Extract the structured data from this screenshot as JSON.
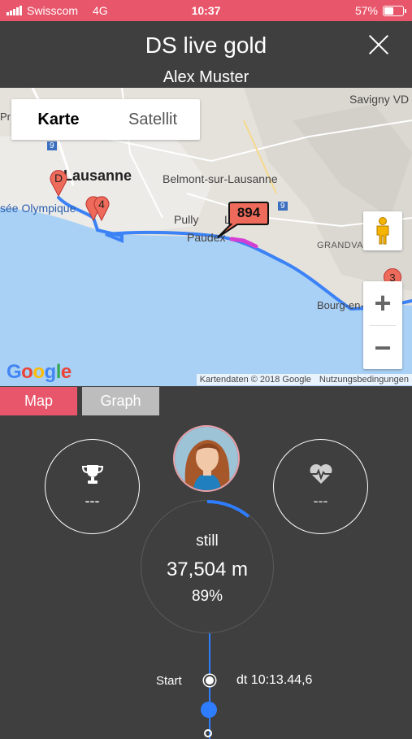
{
  "status_bar": {
    "carrier": "Swisscom",
    "network": "4G",
    "time": "10:37",
    "battery": "57%",
    "battery_level": 0.57
  },
  "header": {
    "title": "DS live gold",
    "subtitle": "Alex Muster"
  },
  "map": {
    "toggle": {
      "map_label": "Karte",
      "satellite_label": "Satellit"
    },
    "place_labels": [
      "Savigny VD",
      "Lausanne",
      "Belmont-sur-Lausanne",
      "Pully",
      "Paudex",
      "GRANDVAUX",
      "Bourg-en-Lavaux",
      "sée Olympique",
      "Pr",
      "L"
    ],
    "road_numbers": [
      "9",
      "9"
    ],
    "markers": [
      "D",
      "4",
      "3"
    ],
    "current_marker": "894",
    "zoom_in": "+",
    "zoom_out": "−",
    "logo": "Google",
    "attribution": "Kartendaten © 2018 Google",
    "terms": "Nutzungsbedingungen",
    "colors": {
      "water": "#a9d0f5",
      "route": "#3b82f6",
      "highlight": "#d33fd3",
      "marker": "#ee6b5b"
    }
  },
  "tabs": {
    "map": "Map",
    "graph": "Graph"
  },
  "stats": {
    "left_icon": "trophy-icon",
    "left_value": "---",
    "right_icon": "heart-rate-icon",
    "right_value": "---",
    "state": "still",
    "distance": "37,504 m",
    "percent": "89%",
    "progress": 0.11
  },
  "timeline": {
    "start_label": "Start",
    "start_time": "dt 10:13.44,6"
  },
  "colors": {
    "accent": "#e8566b",
    "background": "#3f3f3f",
    "progress": "#2e7dff"
  }
}
